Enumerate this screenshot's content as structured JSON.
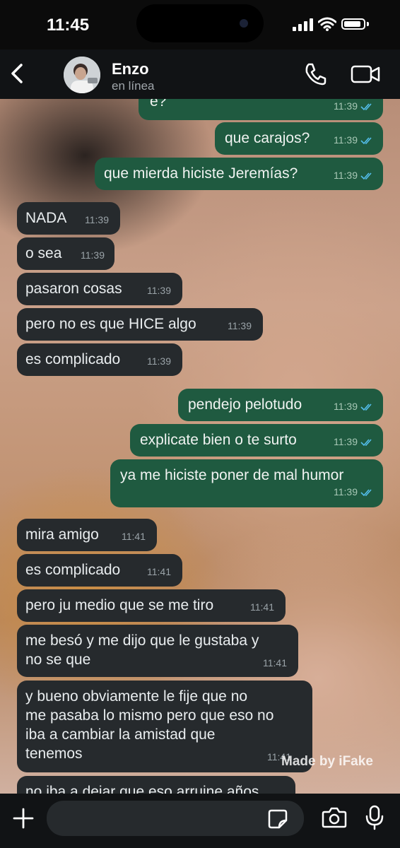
{
  "status_bar": {
    "time": "11:45",
    "battery_level": 0.9
  },
  "header": {
    "contact_name": "Enzo",
    "contact_status": "en línea"
  },
  "messages": [
    {
      "dir": "out",
      "text": "e?",
      "time": "11:39",
      "read": true
    },
    {
      "dir": "out",
      "text": "que carajos?",
      "time": "11:39",
      "read": true
    },
    {
      "dir": "out",
      "text": "que mierda hiciste Jeremías?",
      "time": "11:39",
      "read": true
    },
    {
      "dir": "in",
      "text": "NADA",
      "time": "11:39"
    },
    {
      "dir": "in",
      "text": "o sea",
      "time": "11:39"
    },
    {
      "dir": "in",
      "text": "pasaron cosas",
      "time": "11:39"
    },
    {
      "dir": "in",
      "text": "pero no es que HICE algo",
      "time": "11:39"
    },
    {
      "dir": "in",
      "text": "es complicado",
      "time": "11:39"
    },
    {
      "dir": "out",
      "text": "pendejo pelotudo",
      "time": "11:39",
      "read": true
    },
    {
      "dir": "out",
      "text": "explicate bien o te surto",
      "time": "11:39",
      "read": true
    },
    {
      "dir": "out",
      "text": "ya me hiciste poner de mal humor",
      "time": "11:39",
      "read": true
    },
    {
      "dir": "in",
      "text": "mira amigo",
      "time": "11:41"
    },
    {
      "dir": "in",
      "text": "es complicado",
      "time": "11:41"
    },
    {
      "dir": "in",
      "text": "pero ju medio que se me tiro",
      "time": "11:41"
    },
    {
      "dir": "in",
      "text_lines": [
        "me besó y me dijo que le gustaba y",
        "no se que"
      ],
      "time": "11:41"
    },
    {
      "dir": "in",
      "text_lines": [
        "y bueno obviamente le fije que no",
        "me pasaba lo mismo pero que eso no",
        "iba a cambiar la amistad que",
        "tenemos"
      ],
      "time": "11:41"
    },
    {
      "dir": "in",
      "text": "no iba a dejar que eso arruine años"
    }
  ],
  "watermark": "Made by iFake",
  "icons": {
    "back": "chevron-left-icon",
    "call": "phone-icon",
    "video": "video-camera-icon",
    "plus": "plus-icon",
    "sticker": "sticker-icon",
    "camera": "camera-icon",
    "mic": "microphone-icon"
  },
  "colors": {
    "outgoing_bubble": "#1f5a40",
    "incoming_bubble": "#262a2d",
    "read_ticks": "#53bdeb"
  }
}
